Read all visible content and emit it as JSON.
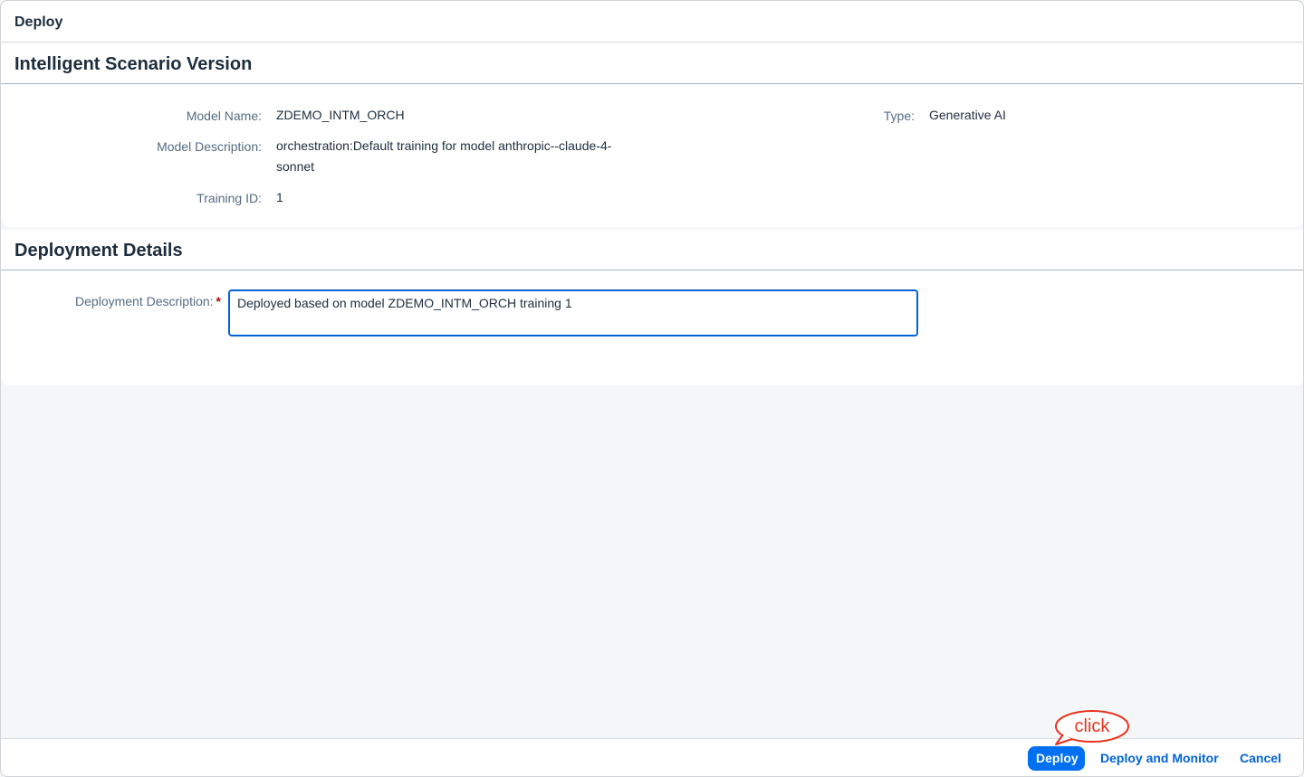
{
  "dialog": {
    "title": "Deploy"
  },
  "scenario_section": {
    "title": "Intelligent Scenario Version",
    "model_name_label": "Model Name:",
    "model_name_value": "ZDEMO_INTM_ORCH",
    "model_description_label": "Model Description:",
    "model_description_line1": "orchestration:Default training for model anthropic--claude-4-",
    "model_description_line2": "sonnet",
    "training_id_label": "Training ID:",
    "training_id_value": "1",
    "type_label": "Type:",
    "type_value": "Generative AI"
  },
  "deployment_section": {
    "title": "Deployment Details",
    "description_label": "Deployment Description:",
    "required_marker": "*",
    "description_value": "Deployed based on model ZDEMO_INTM_ORCH training 1"
  },
  "footer": {
    "deploy_label": "Deploy",
    "deploy_monitor_label": "Deploy and Monitor",
    "cancel_label": "Cancel"
  },
  "annotation": {
    "callout_text": "click",
    "callout_color": "#e8321e"
  },
  "colors": {
    "primary": "#0070f2",
    "link": "#0064d9",
    "label": "#556b82",
    "text": "#1d2d3e",
    "required": "#aa0808"
  }
}
